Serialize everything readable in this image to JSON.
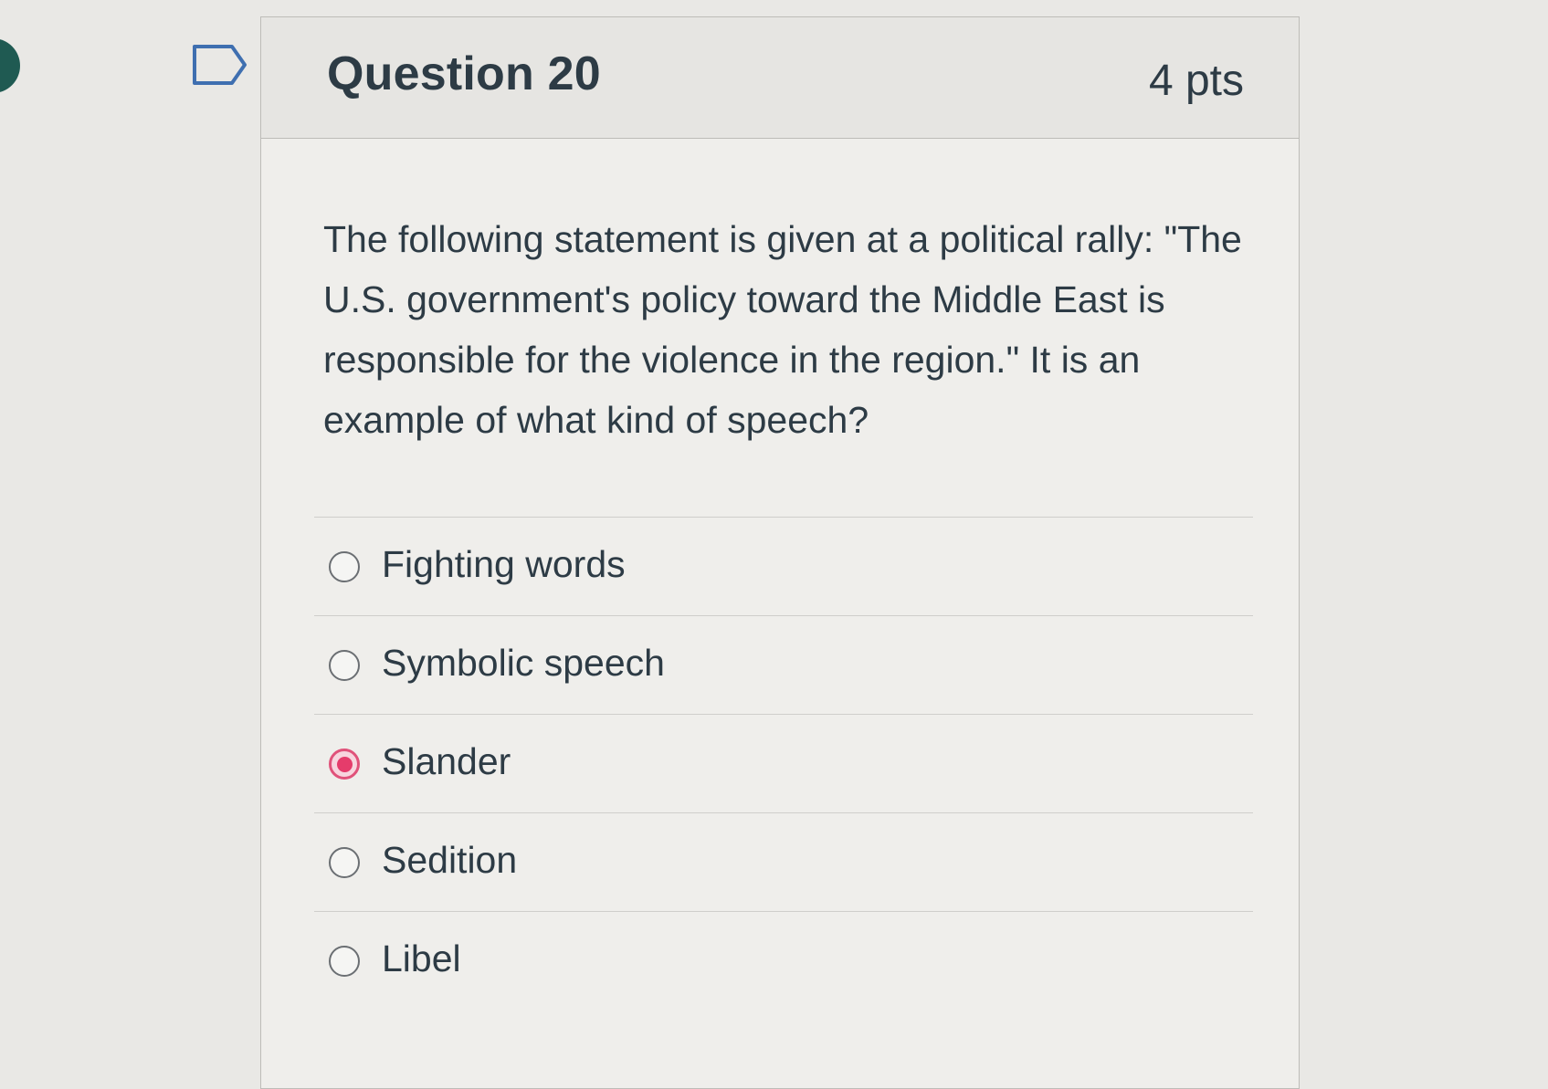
{
  "question": {
    "title": "Question 20",
    "points": "4 pts",
    "text": "The following statement is given at a political rally: \"The U.S. government's policy toward the Middle East is responsible for the violence in the region.\" It is an example of what kind of speech?",
    "flag_icon": "flag-outline-icon"
  },
  "answers": [
    {
      "label": "Fighting words",
      "selected": false
    },
    {
      "label": "Symbolic speech",
      "selected": false
    },
    {
      "label": "Slander",
      "selected": true
    },
    {
      "label": "Sedition",
      "selected": false
    },
    {
      "label": "Libel",
      "selected": false
    }
  ],
  "colors": {
    "selected_radio": "#e53c6b",
    "text": "#2d3b45",
    "header_bg": "#e6e5e2",
    "left_dot": "#1f5a52"
  }
}
